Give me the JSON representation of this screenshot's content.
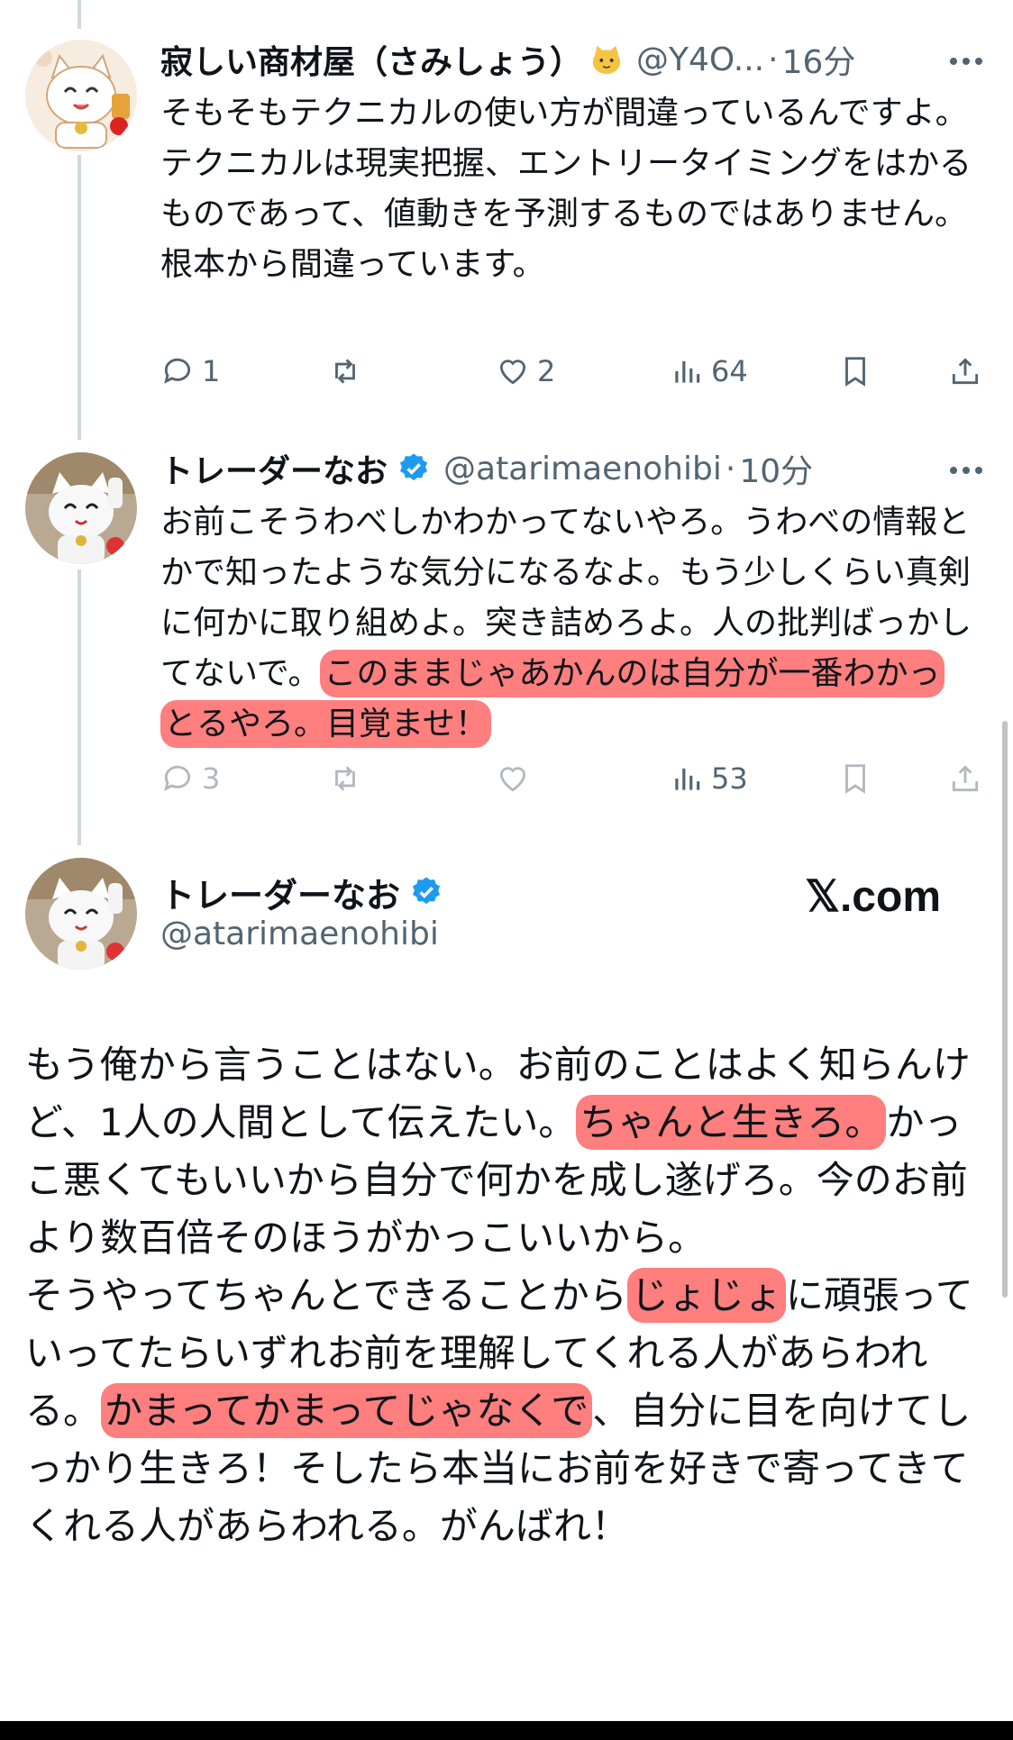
{
  "tweets": [
    {
      "name": "寂しい商材屋（さみしょう）",
      "emoji_icon": "cat-face-icon",
      "handle": "@Y4O...",
      "sep": "·",
      "time": "16分",
      "body": "そもそもテクニカルの使い方が間違っているんですよ。\nテクニカルは現実把握、エントリータイミングをはかるものであって、値動きを予測するものではありません。根本から間違っています。",
      "actions": {
        "reply": "1",
        "repost": "",
        "like": "2",
        "views": "64"
      }
    },
    {
      "name": "トレーダーなお",
      "verified": true,
      "handle": "@atarimaenohibi",
      "sep": "·",
      "time": "10分",
      "body_plain": "お前こそうわべしかわかってないやろ。うわべの情報とかで知ったような気分になるなよ。もう少しくらい真剣に何かに取り組めよ。突き詰めろよ。人の批判ばっかしてないで。",
      "body_highlight": "このままじゃあかんのは自分が一番わかっとるやろ。目覚ませ！",
      "actions": {
        "reply": "3",
        "repost": "",
        "like": "",
        "views": "53"
      }
    }
  ],
  "quote": {
    "name": "トレーダーなお",
    "handle": "@atarimaenohibi",
    "site": "𝕏.com",
    "segments": [
      "もう俺から言うことはない。お前のことはよく知らんけど、1人の人間として伝えたい。",
      "ちゃんと生きろ。",
      "かっこ悪くてもいいから自分で何かを成し遂げろ。今のお前より数百倍そのほうがかっこいいから。\nそうやってちゃんとできることから",
      "じょじょ",
      "に頑張っていってたらいずれお前を理解してくれる人があらわれる。",
      "かまってかまってじゃなくで",
      "、自分に目を向けてしっかり生きろ！そしたら本当にお前を好きで寄ってきてくれる人があらわれる。がんばれ！"
    ]
  },
  "colors": {
    "highlight": "#ff5a5a",
    "verified": "#1d9bf0",
    "secondary_text": "#536471"
  }
}
